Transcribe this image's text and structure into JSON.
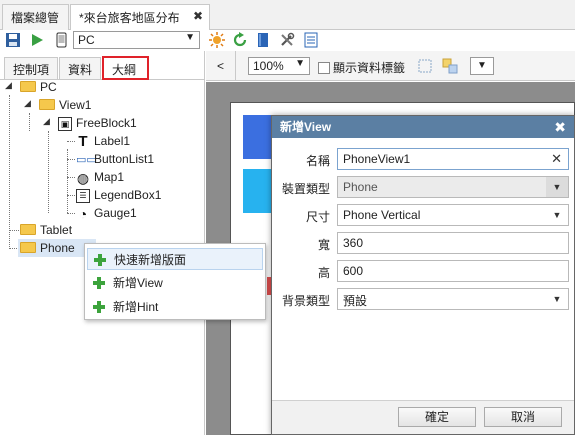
{
  "tabs": {
    "files": "檔案總管",
    "map": "*來台旅客地區分布",
    "close_glyph": "✖"
  },
  "toolbar": {
    "device_value": "PC",
    "icons": [
      "save-icon",
      "run-icon",
      "phone-icon",
      "settings-sun-icon",
      "refresh-icon",
      "book-icon",
      "tools-icon",
      "list-icon"
    ]
  },
  "left_panel": {
    "tabs": {
      "controls": "控制項",
      "data": "資料",
      "outline": "大綱"
    },
    "tree": {
      "pc": "PC",
      "view1": "View1",
      "freeblock1": "FreeBlock1",
      "label1": "Label1",
      "buttonlist1": "ButtonList1",
      "map1": "Map1",
      "legendbox1": "LegendBox1",
      "gauge1": "Gauge1",
      "tablet": "Tablet",
      "phone": "Phone"
    }
  },
  "context_menu": {
    "items": [
      "快速新增版面",
      "新增View",
      "新增Hint"
    ]
  },
  "right_toolbar": {
    "collapse": "<",
    "zoom": "100%",
    "show_labels": "顯示資料標籤"
  },
  "dialog": {
    "title": "新增View",
    "close": "✖",
    "fields": {
      "name_label": "名稱",
      "name_value": "PhoneView1",
      "device_type_label": "裝置類型",
      "device_type_value": "Phone",
      "size_label": "尺寸",
      "size_value": "Phone Vertical",
      "width_label": "寬",
      "width_value": "360",
      "height_label": "高",
      "height_value": "600",
      "bg_type_label": "背景類型",
      "bg_type_value": "預設"
    },
    "buttons": {
      "ok": "確定",
      "cancel": "取消"
    }
  },
  "colors": {
    "dialog_title_bg": "#5b7fa3",
    "highlight_border": "#e0222a",
    "menu_plus": "#3ca33c",
    "canvas_blue_1": "#3b6fe0",
    "canvas_blue_2": "#27b2ef"
  }
}
